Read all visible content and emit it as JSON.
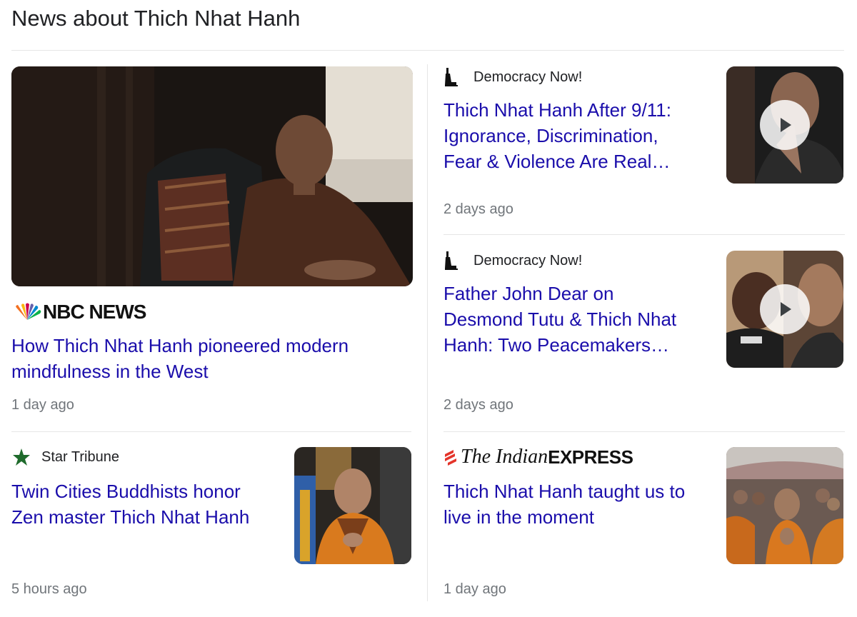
{
  "section_title": "News about Thich Nhat Hanh",
  "articles": [
    {
      "source": "NBC NEWS",
      "headline_1": "How Thich Nhat Hanh pioneered modern",
      "headline_2": "mindfulness in the West",
      "time": "1 day ago"
    },
    {
      "source": "Democracy Now!",
      "headline_1": "Thich Nhat Hanh After 9/11:",
      "headline_2": "Ignorance, Discrimination,",
      "headline_3": "Fear & Violence Are Real…",
      "time": "2 days ago"
    },
    {
      "source": "Democracy Now!",
      "headline_1": "Father John Dear on",
      "headline_2": "Desmond Tutu & Thich Nhat",
      "headline_3": "Hanh: Two Peacemakers…",
      "time": "2 days ago"
    },
    {
      "source": "Star Tribune",
      "headline_1": "Twin Cities Buddhists honor",
      "headline_2": "Zen master Thich Nhat Hanh",
      "time": "5 hours ago"
    },
    {
      "source_the": "The Indian",
      "source_ex": "EXPRESS",
      "headline_1": "Thich Nhat Hanh taught us to",
      "headline_2": "live in the moment",
      "time": "1 day ago"
    }
  ],
  "colors": {
    "link": "#1a0dab",
    "meta": "#70757a",
    "divider": "#e6e6e6"
  },
  "icons": [
    "statue-of-liberty-icon",
    "nbc-peacock-icon",
    "star-icon",
    "indian-express-mark-icon",
    "play-icon"
  ]
}
